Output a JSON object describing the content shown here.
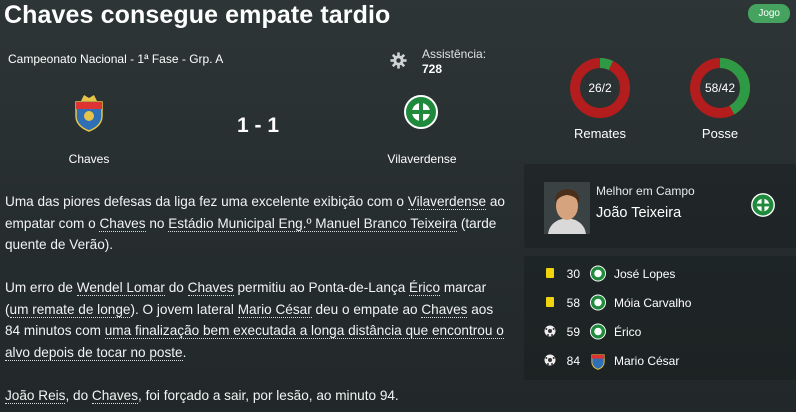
{
  "header": {
    "title": "Chaves consegue empate tardio",
    "jogo_button": "Jogo"
  },
  "match": {
    "competition": "Campeonato Nacional - 1ª Fase - Grp. A",
    "attendance_label": "Assistência:",
    "attendance_value": "728",
    "home_team": "Chaves",
    "away_team": "Vilaverdense",
    "score": "1 - 1"
  },
  "stats": {
    "remates": {
      "label": "Remates",
      "text": "26/2",
      "home": 26,
      "away": 2
    },
    "posse": {
      "label": "Posse",
      "text": "58/42",
      "home": 58,
      "away": 42
    },
    "home_color": "#b31d1d",
    "away_color": "#2f9a46"
  },
  "mom": {
    "label": "Melhor em Campo",
    "name": "João Teixeira"
  },
  "events": [
    {
      "type": "yellow-card",
      "minute": "30",
      "team": "away",
      "player": "José Lopes"
    },
    {
      "type": "yellow-card",
      "minute": "58",
      "team": "away",
      "player": "Móia Carvalho"
    },
    {
      "type": "goal",
      "minute": "59",
      "team": "away",
      "player": "Érico"
    },
    {
      "type": "goal",
      "minute": "84",
      "team": "home",
      "player": "Mario César"
    }
  ],
  "report": {
    "p1": {
      "a": "Uma das piores defesas da liga fez uma excelente exibição com o",
      "l1": "Vilaverdense",
      "b": "ao empatar com o",
      "l2": "Chaves",
      "c": "no",
      "l3": "Estádio Municipal Eng.º Manuel Branco Teixeira",
      "d": "(tarde quente de Verão)."
    },
    "p2": {
      "a": "Um erro de",
      "l1": "Wendel Lomar",
      "b": "do",
      "l2": "Chaves",
      "c": "permitiu ao Ponta-de-Lança",
      "l3": "Érico",
      "d": "marcar (",
      "l4": "um remate de longe",
      "e": "). O jovem lateral",
      "l5": "Mario César",
      "f": "deu o empate ao",
      "l6": "Chaves",
      "g": "aos 84 minutos com",
      "l7": "uma finalização bem executada a longa distância que encontrou o alvo depois de tocar no poste",
      "h": "."
    },
    "p3": {
      "l1": "João Reis",
      "a": ", do",
      "l2": "Chaves",
      "b": ", foi forçado a sair, por lesão, ao minuto 94."
    }
  }
}
